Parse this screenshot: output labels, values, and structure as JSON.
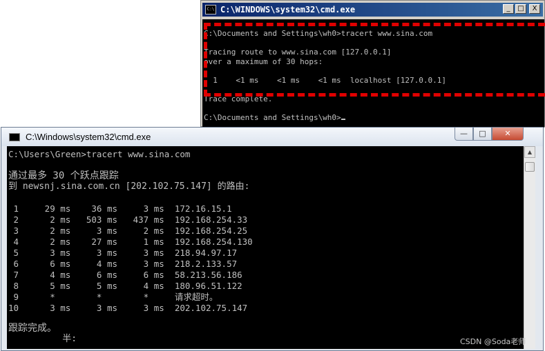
{
  "xp_window": {
    "title": "C:\\WINDOWS\\system32\\cmd.exe",
    "title_icon": "C:\\",
    "buttons": {
      "minimize": "_",
      "maximize": "□",
      "close": "X"
    },
    "lines": [
      "C:\\Documents and Settings\\wh0>tracert www.sina.com",
      "Tracing route to www.sina.com [127.0.0.1]",
      "over a maximum of 30 hops:",
      "  1    <1 ms    <1 ms    <1 ms  localhost [127.0.0.1]",
      "Trace complete.",
      "C:\\Documents and Settings\\wh0>"
    ]
  },
  "w7_window": {
    "title": "C:\\Windows\\system32\\cmd.exe",
    "buttons": {
      "minimize": "—",
      "maximize": "□",
      "close": "✕"
    },
    "command": "C:\\Users\\Green>tracert www.sina.com",
    "header1": "通过最多 30 个跃点跟踪",
    "header2": "到 newsnj.sina.com.cn [202.102.75.147] 的路由:",
    "hops": [
      " 1     29 ms    36 ms     3 ms  172.16.15.1",
      " 2      2 ms   503 ms   437 ms  192.168.254.33",
      " 3      2 ms     3 ms     2 ms  192.168.254.25",
      " 4      2 ms    27 ms     1 ms  192.168.254.130",
      " 5      3 ms     3 ms     3 ms  218.94.97.17",
      " 6      6 ms     4 ms     3 ms  218.2.133.57",
      " 7      4 ms     6 ms     6 ms  58.213.56.186",
      " 8      5 ms     5 ms     4 ms  180.96.51.122",
      " 9      *        *        *     请求超时。",
      "10      3 ms     3 ms     3 ms  202.102.75.147"
    ],
    "footer": "跟踪完成。",
    "ime": "          半:"
  },
  "watermark": "CSDN @Soda老师",
  "colors": {
    "console_bg": "#000000",
    "console_text": "#c0c0c0",
    "highlight": "#e00000"
  }
}
